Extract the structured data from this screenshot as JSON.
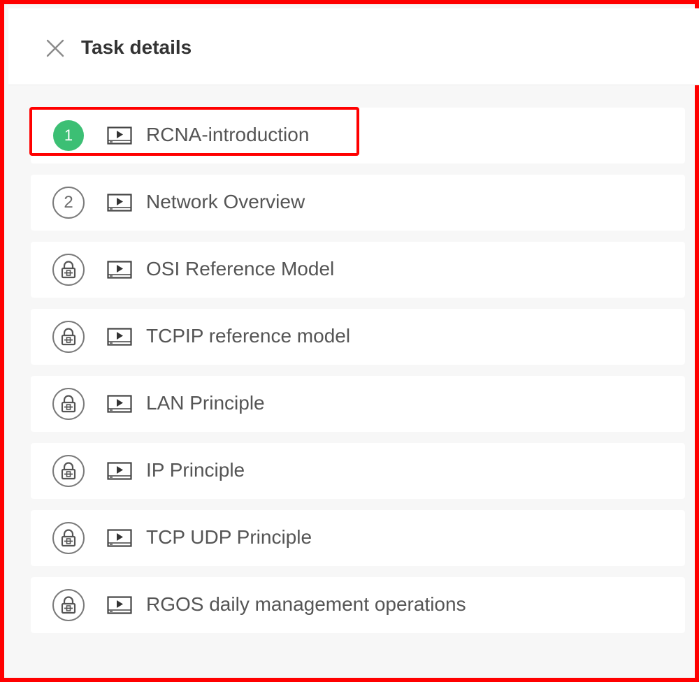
{
  "header": {
    "title": "Task details",
    "close_icon": "close-icon"
  },
  "colors": {
    "frame": "#ff0000",
    "completed_badge": "#3cbf74",
    "list_background": "#f7f7f7"
  },
  "tasks": [
    {
      "badge": "1",
      "status": "completed",
      "type_icon": "video-icon",
      "label": "RCNA-introduction"
    },
    {
      "badge": "2",
      "status": "next",
      "type_icon": "video-icon",
      "label": "Network Overview"
    },
    {
      "badge": "",
      "status": "locked",
      "type_icon": "video-icon",
      "label": "OSI Reference Model"
    },
    {
      "badge": "",
      "status": "locked",
      "type_icon": "video-icon",
      "label": "TCPIP reference model"
    },
    {
      "badge": "",
      "status": "locked",
      "type_icon": "video-icon",
      "label": "LAN Principle"
    },
    {
      "badge": "",
      "status": "locked",
      "type_icon": "video-icon",
      "label": "IP Principle"
    },
    {
      "badge": "",
      "status": "locked",
      "type_icon": "video-icon",
      "label": "TCP UDP Principle"
    },
    {
      "badge": "",
      "status": "locked",
      "type_icon": "video-icon",
      "label": "RGOS daily management operations"
    }
  ]
}
